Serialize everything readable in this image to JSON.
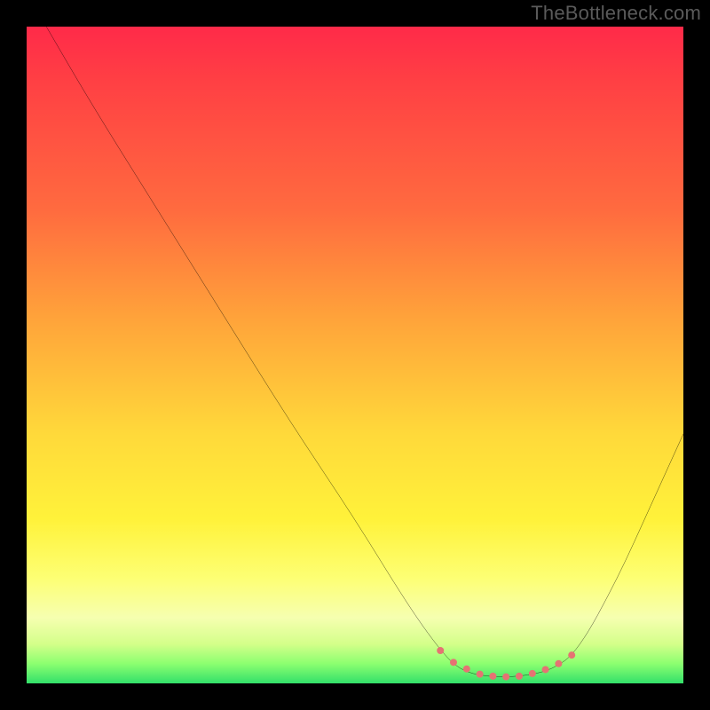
{
  "watermark": "TheBottleneck.com",
  "chart_data": {
    "type": "line",
    "title": "",
    "xlabel": "",
    "ylabel": "",
    "xlim": [
      0,
      100
    ],
    "ylim": [
      0,
      100
    ],
    "grid": false,
    "legend": false,
    "curve": {
      "name": "bottleneck-curve",
      "color": "#000000",
      "points": [
        {
          "x": 3,
          "y": 100
        },
        {
          "x": 10,
          "y": 88
        },
        {
          "x": 20,
          "y": 72
        },
        {
          "x": 30,
          "y": 56
        },
        {
          "x": 40,
          "y": 40
        },
        {
          "x": 50,
          "y": 25
        },
        {
          "x": 58,
          "y": 12
        },
        {
          "x": 63,
          "y": 5
        },
        {
          "x": 66,
          "y": 2
        },
        {
          "x": 70,
          "y": 1
        },
        {
          "x": 75,
          "y": 1
        },
        {
          "x": 80,
          "y": 2
        },
        {
          "x": 84,
          "y": 5
        },
        {
          "x": 90,
          "y": 16
        },
        {
          "x": 95,
          "y": 27
        },
        {
          "x": 100,
          "y": 38
        }
      ]
    },
    "markers": {
      "name": "valley-markers",
      "color": "#e57373",
      "radius": 4,
      "points": [
        {
          "x": 63,
          "y": 5
        },
        {
          "x": 65,
          "y": 3.2
        },
        {
          "x": 67,
          "y": 2.2
        },
        {
          "x": 69,
          "y": 1.4
        },
        {
          "x": 71,
          "y": 1.1
        },
        {
          "x": 73,
          "y": 1.0
        },
        {
          "x": 75,
          "y": 1.1
        },
        {
          "x": 77,
          "y": 1.5
        },
        {
          "x": 79,
          "y": 2.1
        },
        {
          "x": 81,
          "y": 3.0
        },
        {
          "x": 83,
          "y": 4.3
        }
      ]
    },
    "gradient_stops": [
      {
        "pos": 0,
        "color": "#ff2a49"
      },
      {
        "pos": 8,
        "color": "#ff3f44"
      },
      {
        "pos": 28,
        "color": "#ff6b3f"
      },
      {
        "pos": 45,
        "color": "#ffa53a"
      },
      {
        "pos": 62,
        "color": "#ffd93a"
      },
      {
        "pos": 75,
        "color": "#fff23a"
      },
      {
        "pos": 84,
        "color": "#fdff74"
      },
      {
        "pos": 90,
        "color": "#f6ffb0"
      },
      {
        "pos": 94,
        "color": "#d4ff8a"
      },
      {
        "pos": 97,
        "color": "#8cff70"
      },
      {
        "pos": 100,
        "color": "#33e06a"
      }
    ]
  }
}
